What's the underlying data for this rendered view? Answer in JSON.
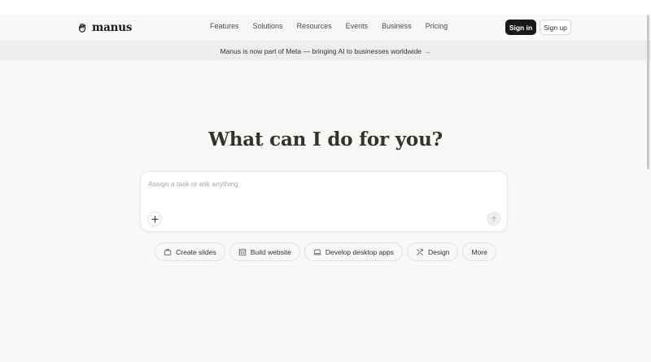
{
  "brand": {
    "name": "manus",
    "logo_icon": "manus-hand-icon"
  },
  "nav": {
    "links": [
      "Features",
      "Solutions",
      "Resources",
      "Events",
      "Business",
      "Pricing"
    ],
    "sign_in": "Sign in",
    "sign_up": "Sign up"
  },
  "banner": {
    "text": "Manus is now part of Meta — bringing AI to businesses worldwide",
    "arrow": "→"
  },
  "hero": {
    "heading": "What can I do for you?"
  },
  "composer": {
    "placeholder": "Assign a task or ask anything",
    "value": "",
    "add_icon": "plus-icon",
    "send_icon": "arrow-up-icon"
  },
  "chips": [
    {
      "label": "Create slides",
      "icon": "slides-icon"
    },
    {
      "label": "Build website",
      "icon": "website-icon"
    },
    {
      "label": "Develop desktop apps",
      "icon": "laptop-icon"
    },
    {
      "label": "Design",
      "icon": "design-icon"
    },
    {
      "label": "More",
      "icon": ""
    }
  ],
  "colors": {
    "background": "#f8f8f7",
    "banner_bg": "#eeeeec",
    "primary_button": "#1a1a19",
    "text": "#34322d",
    "placeholder": "#a6a49f"
  }
}
